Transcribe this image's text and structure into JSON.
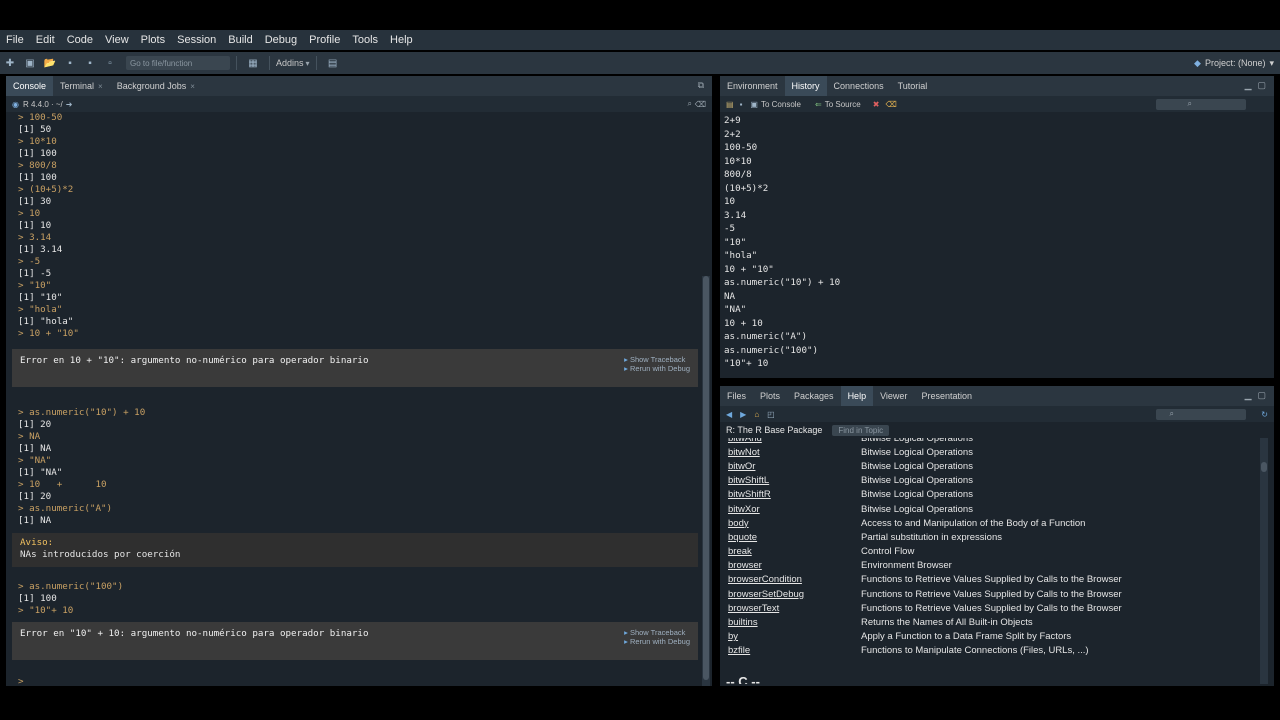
{
  "menu": [
    "File",
    "Edit",
    "Code",
    "View",
    "Plots",
    "Session",
    "Build",
    "Debug",
    "Profile",
    "Tools",
    "Help"
  ],
  "toolbar": {
    "goto_placeholder": "Go to file/function",
    "addins": "Addins",
    "project": "Project: (None)"
  },
  "console_pane": {
    "tabs": [
      "Console",
      "Terminal",
      "Background Jobs"
    ],
    "r_version": "R 4.4.0 · ~/",
    "lines_top": [
      {
        "t": "cmd",
        "v": "> 100-50"
      },
      {
        "t": "out",
        "v": "[1] 50"
      },
      {
        "t": "cmd",
        "v": "> 10*10"
      },
      {
        "t": "out",
        "v": "[1] 100"
      },
      {
        "t": "cmd",
        "v": "> 800/8"
      },
      {
        "t": "out",
        "v": "[1] 100"
      },
      {
        "t": "cmd",
        "v": "> (10+5)*2"
      },
      {
        "t": "out",
        "v": "[1] 30"
      },
      {
        "t": "cmd",
        "v": "> 10"
      },
      {
        "t": "out",
        "v": "[1] 10"
      },
      {
        "t": "cmd",
        "v": "> 3.14"
      },
      {
        "t": "out",
        "v": "[1] 3.14"
      },
      {
        "t": "cmd",
        "v": "> -5"
      },
      {
        "t": "out",
        "v": "[1] -5"
      },
      {
        "t": "cmd",
        "v": "> \"10\""
      },
      {
        "t": "out",
        "v": "[1] \"10\""
      },
      {
        "t": "cmd",
        "v": "> \"hola\""
      },
      {
        "t": "out",
        "v": "[1] \"hola\""
      },
      {
        "t": "cmd",
        "v": "> 10 + \"10\""
      }
    ],
    "error1": "Error en 10 + \"10\": argumento no-numérico para operador binario",
    "traceback": "Show Traceback",
    "rerun": "Rerun with Debug",
    "lines_mid": [
      {
        "t": "cmd",
        "v": "> as.numeric(\"10\") + 10"
      },
      {
        "t": "out",
        "v": "[1] 20"
      },
      {
        "t": "cmd",
        "v": "> NA"
      },
      {
        "t": "out",
        "v": "[1] NA"
      },
      {
        "t": "cmd",
        "v": "> \"NA\""
      },
      {
        "t": "out",
        "v": "[1] \"NA\""
      },
      {
        "t": "cmd",
        "v": "> 10   +      10"
      },
      {
        "t": "out",
        "v": "[1] 20"
      },
      {
        "t": "cmd",
        "v": "> as.numeric(\"A\")"
      },
      {
        "t": "out",
        "v": "[1] NA"
      }
    ],
    "warning_title": "Aviso:",
    "warning_text": "NAs introducidos por coerción",
    "lines_bot": [
      {
        "t": "cmd",
        "v": "> as.numeric(\"100\")"
      },
      {
        "t": "out",
        "v": "[1] 100"
      },
      {
        "t": "cmd",
        "v": "> \"10\"+ 10"
      }
    ],
    "error2": "Error en \"10\" + 10: argumento no-numérico para operador binario",
    "prompt": ">"
  },
  "history_pane": {
    "tabs": [
      "Environment",
      "History",
      "Connections",
      "Tutorial"
    ],
    "to_console": "To Console",
    "to_source": "To Source",
    "items": [
      "2+9",
      "2+2",
      "100-50",
      "10*10",
      "800/8",
      "(10+5)*2",
      "10",
      "3.14",
      "-5",
      "\"10\"",
      "\"hola\"",
      "10 + \"10\"",
      "as.numeric(\"10\") + 10",
      "NA",
      "\"NA\"",
      "10 + 10",
      "as.numeric(\"A\")",
      "as.numeric(\"100\")",
      "\"10\"+ 10"
    ]
  },
  "help_pane": {
    "tabs": [
      "Files",
      "Plots",
      "Packages",
      "Help",
      "Viewer",
      "Presentation"
    ],
    "package_title": "R: The R Base Package",
    "find_in_topic": "Find in Topic",
    "rows": [
      {
        "fn": "bitwAnd",
        "desc": "Bitwise Logical Operations"
      },
      {
        "fn": "bitwNot",
        "desc": "Bitwise Logical Operations"
      },
      {
        "fn": "bitwOr",
        "desc": "Bitwise Logical Operations"
      },
      {
        "fn": "bitwShiftL",
        "desc": "Bitwise Logical Operations"
      },
      {
        "fn": "bitwShiftR",
        "desc": "Bitwise Logical Operations"
      },
      {
        "fn": "bitwXor",
        "desc": "Bitwise Logical Operations"
      },
      {
        "fn": "body",
        "desc": "Access to and Manipulation of the Body of a Function"
      },
      {
        "fn": "bquote",
        "desc": "Partial substitution in expressions"
      },
      {
        "fn": "break",
        "desc": "Control Flow"
      },
      {
        "fn": "browser",
        "desc": "Environment Browser"
      },
      {
        "fn": "browserCondition",
        "desc": "Functions to Retrieve Values Supplied by Calls to the Browser"
      },
      {
        "fn": "browserSetDebug",
        "desc": "Functions to Retrieve Values Supplied by Calls to the Browser"
      },
      {
        "fn": "browserText",
        "desc": "Functions to Retrieve Values Supplied by Calls to the Browser"
      },
      {
        "fn": "builtins",
        "desc": "Returns the Names of All Built-in Objects"
      },
      {
        "fn": "by",
        "desc": "Apply a Function to a Data Frame Split by Factors"
      },
      {
        "fn": "bzfile",
        "desc": "Functions to Manipulate Connections (Files, URLs, ...)"
      }
    ],
    "section": "-- C --"
  }
}
